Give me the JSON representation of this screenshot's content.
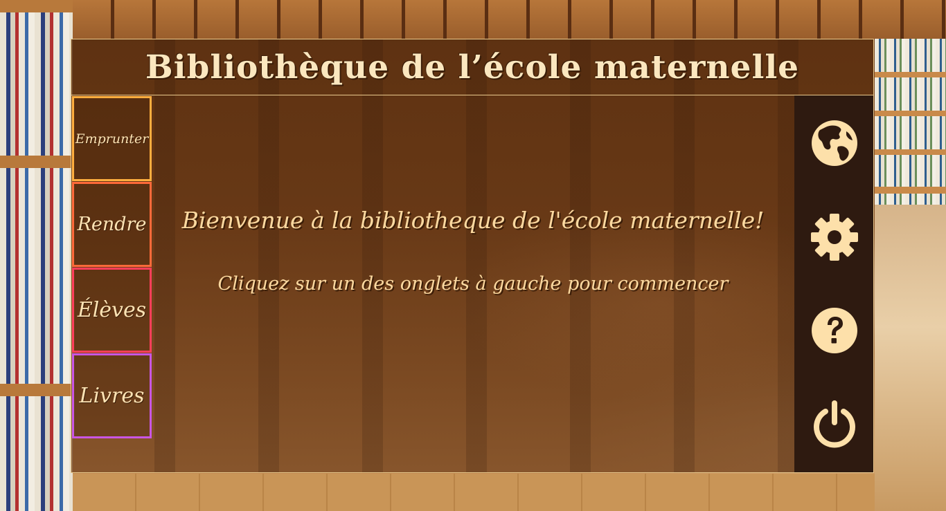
{
  "app": {
    "title": "Bibliothèque de l’école maternelle"
  },
  "tabs": [
    {
      "label": "Emprunter"
    },
    {
      "label": "Rendre"
    },
    {
      "label": "Élèves"
    },
    {
      "label": "Livres"
    }
  ],
  "main": {
    "welcome": "Bienvenue à la bibliotheque de l'école maternelle!",
    "instruction": "Cliquez sur un des onglets à gauche pour commencer"
  },
  "sidebar": {
    "buttons": [
      {
        "icon": "globe-icon"
      },
      {
        "icon": "gear-icon"
      },
      {
        "icon": "question-icon"
      },
      {
        "icon": "power-icon"
      }
    ]
  },
  "colors": {
    "accent_text": "#fcd9a0",
    "sidebar_bg": "#2e1a10",
    "tab_borders": [
      "#ffae3f",
      "#ff6a3a",
      "#ff3f5a",
      "#c956e4"
    ]
  }
}
